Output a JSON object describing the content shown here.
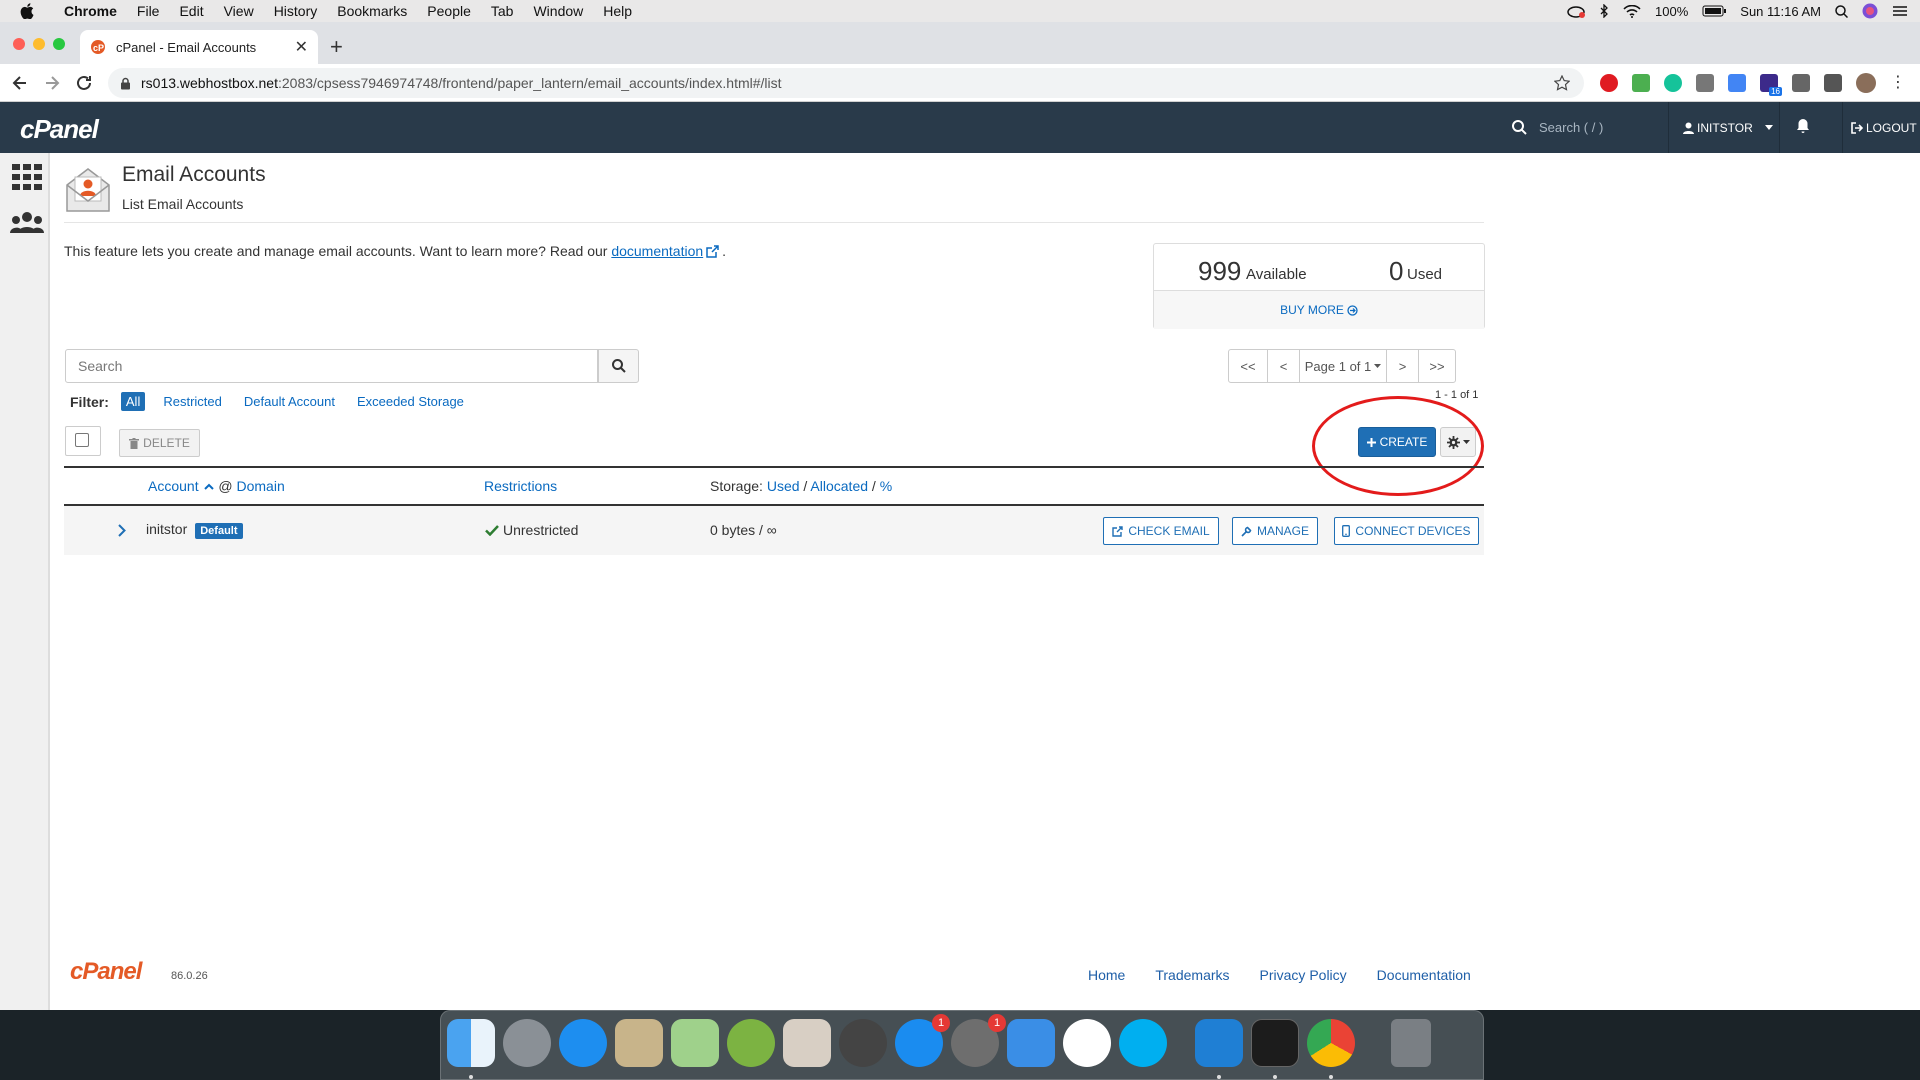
{
  "menubar": {
    "app": "Chrome",
    "items": [
      "File",
      "Edit",
      "View",
      "History",
      "Bookmarks",
      "People",
      "Tab",
      "Window",
      "Help"
    ],
    "battery": "100%",
    "clock": "Sun 11:16 AM"
  },
  "browser": {
    "tab_title": "cPanel - Email Accounts",
    "url_host": "rs013.webhostbox.net",
    "url_rest": ":2083/cpsess7946974748/frontend/paper_lantern/email_accounts/index.html#/list",
    "ext_badge": "16"
  },
  "cpanel": {
    "logo": "cPanel",
    "search_placeholder": "Search ( / )",
    "user": "INITSTOR",
    "logout": "LOGOUT"
  },
  "page": {
    "title": "Email Accounts",
    "subtitle": "List Email Accounts",
    "intro_text": "This feature lets you create and manage email accounts. Want to learn more? Read our ",
    "doc_link": "documentation",
    "intro_end": "."
  },
  "stats": {
    "available_num": "999",
    "available_label": "Available",
    "used_num": "0",
    "used_label": "Used",
    "buy_more": "BUY MORE"
  },
  "toolbar": {
    "search_placeholder": "Search",
    "pager": [
      "<<",
      "<",
      "Page 1 of 1",
      ">",
      ">>"
    ],
    "count": "1 - 1 of 1",
    "filter_label": "Filter:",
    "filters": [
      "All",
      "Restricted",
      "Default Account",
      "Exceeded Storage"
    ],
    "delete": "DELETE",
    "create": "CREATE"
  },
  "table": {
    "col_account": "Account",
    "col_at": "@",
    "col_domain": "Domain",
    "col_restrictions": "Restrictions",
    "col_storage": "Storage:",
    "col_used": "Used",
    "col_allocated": "Allocated",
    "col_percent": "%",
    "slash": "/",
    "rows": [
      {
        "account": "initstor",
        "badge": "Default",
        "restriction": "Unrestricted",
        "storage": "0 bytes / ∞",
        "btn_check": "CHECK EMAIL",
        "btn_manage": "MANAGE",
        "btn_connect": "CONNECT DEVICES"
      }
    ]
  },
  "footer": {
    "logo": "cPanel",
    "version": "86.0.26",
    "links": [
      "Home",
      "Trademarks",
      "Privacy Policy",
      "Documentation"
    ]
  },
  "dock": {
    "badge_appstore": "1",
    "badge_prefs": "1"
  },
  "colors": {
    "cpanel_header": "#293a4a",
    "primary": "#1f6fb5",
    "annotation": "#e31b1b",
    "cpanel_orange": "#e45a26"
  }
}
